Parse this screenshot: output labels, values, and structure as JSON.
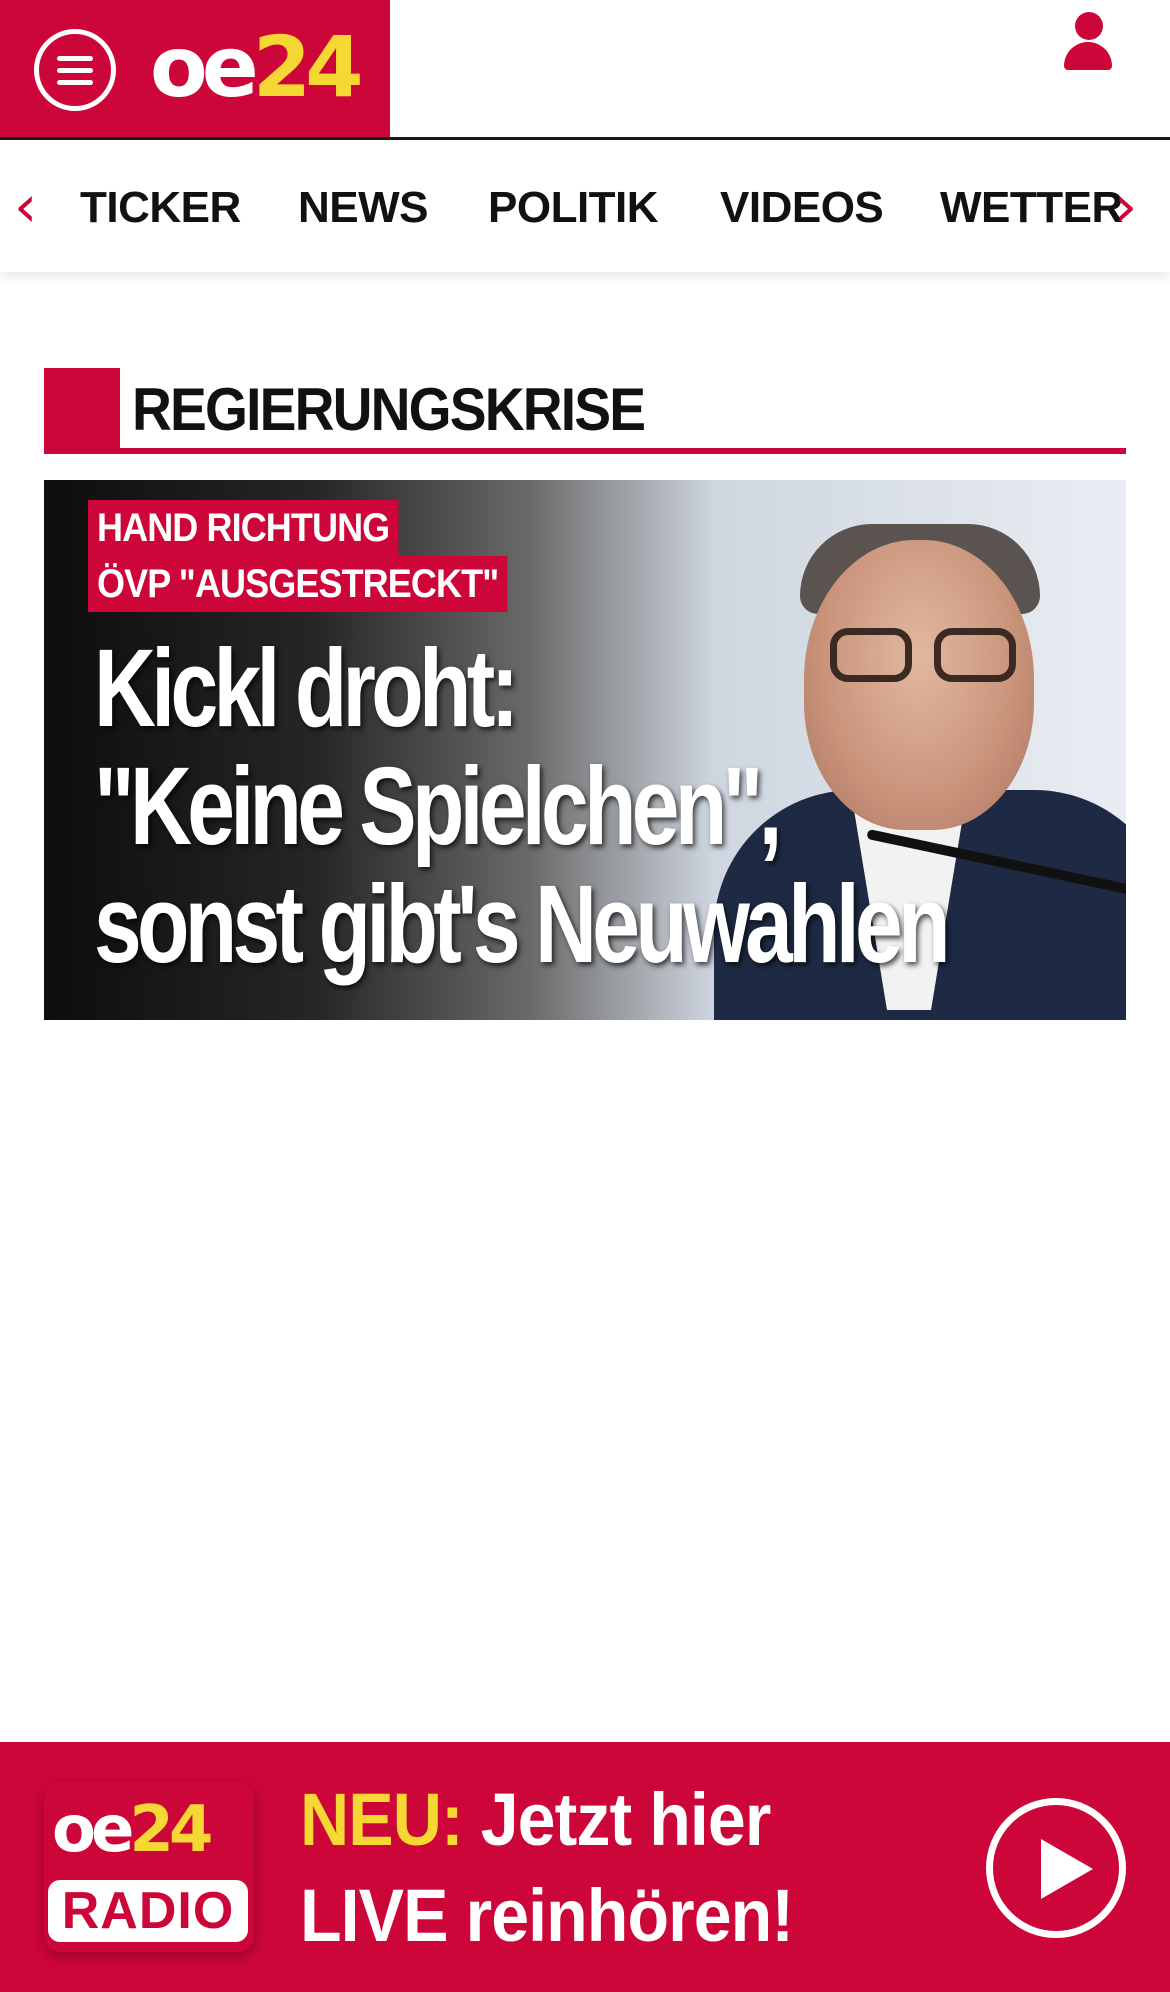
{
  "header": {
    "logo_oe": "oe",
    "logo_num": "24"
  },
  "nav": {
    "items": [
      "TICKER",
      "NEWS",
      "POLITIK",
      "VIDEOS",
      "WETTER"
    ]
  },
  "section": {
    "title": "REGIERUNGSKRISE"
  },
  "hero": {
    "kicker_line1": "HAND RICHTUNG",
    "kicker_line2": "ÖVP \"AUSGESTRECKT\"",
    "headline_line1": "Kickl droht:",
    "headline_line2": "\"Keine Spielchen\",",
    "headline_line3": "sonst gibt's Neuwahlen"
  },
  "radio": {
    "logo_oe": "oe",
    "logo_num": "24",
    "badge_label": "RADIO",
    "promo_neu": "NEU:",
    "promo_line1_rest": " Jetzt hier",
    "promo_line2": "LIVE reinhören!"
  },
  "colors": {
    "brand_red": "#cc0638",
    "accent_yellow": "#f5d833"
  }
}
